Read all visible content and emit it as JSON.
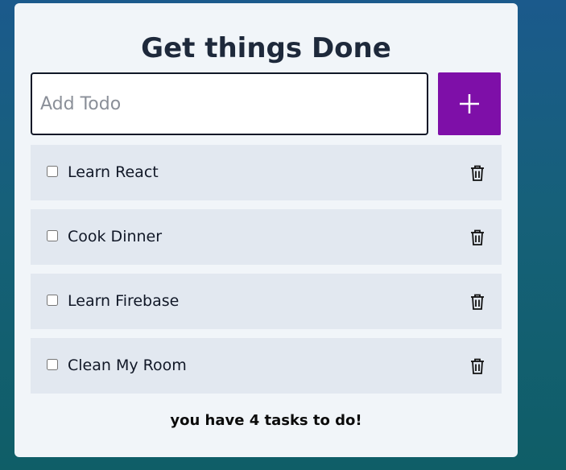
{
  "app": {
    "title": "Get things Done"
  },
  "input": {
    "placeholder": "Add Todo",
    "value": ""
  },
  "add_button": {
    "icon": "plus-icon"
  },
  "todos": [
    {
      "label": "Learn React",
      "checked": false
    },
    {
      "label": "Cook Dinner",
      "checked": false
    },
    {
      "label": "Learn Firebase",
      "checked": false
    },
    {
      "label": "Clean My Room",
      "checked": false
    }
  ],
  "delete_icon": "trash-icon",
  "footer": {
    "text": "you have 4 tasks to do!"
  },
  "colors": {
    "accent": "#7e0fa8",
    "card_bg": "#f1f5f9",
    "item_bg": "#e2e8f0",
    "title": "#1e293b"
  }
}
